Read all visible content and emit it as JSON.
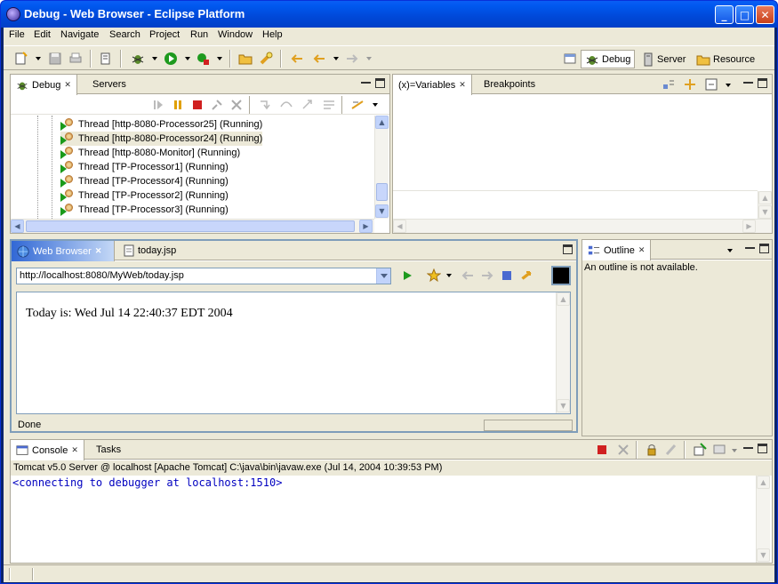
{
  "window": {
    "title": "Debug - Web Browser - Eclipse Platform",
    "buttons": {
      "minimize": "_",
      "maximize": "□",
      "close": "✕"
    }
  },
  "menu": [
    "File",
    "Edit",
    "Navigate",
    "Search",
    "Project",
    "Run",
    "Window",
    "Help"
  ],
  "perspectives": [
    {
      "label": "Debug",
      "icon": "debug-bug-icon",
      "active": true
    },
    {
      "label": "Server",
      "icon": "server-icon",
      "active": false
    },
    {
      "label": "Resource",
      "icon": "resource-folder-icon",
      "active": false
    }
  ],
  "debug_view": {
    "tabs": [
      {
        "label": "Debug",
        "active": true
      },
      {
        "label": "Servers",
        "active": false
      }
    ],
    "threads": [
      "Thread [http-8080-Processor25] (Running)",
      "Thread [http-8080-Processor24] (Running)",
      "Thread [http-8080-Monitor] (Running)",
      "Thread [TP-Processor1] (Running)",
      "Thread [TP-Processor4] (Running)",
      "Thread [TP-Processor2] (Running)",
      "Thread [TP-Processor3] (Running)"
    ]
  },
  "variables_view": {
    "tabs": [
      {
        "label": "(x)=Variables",
        "active": true
      },
      {
        "label": "Breakpoints",
        "active": false
      }
    ]
  },
  "browser_view": {
    "tabs": [
      {
        "label": "Web Browser",
        "active": true
      },
      {
        "label": "today.jsp",
        "active": false
      }
    ],
    "url": "http://localhost:8080/MyWeb/today.jsp",
    "content": "Today is: Wed Jul 14 22:40:37 EDT 2004",
    "status": "Done"
  },
  "outline_view": {
    "tab": "Outline",
    "message": "An outline is not available."
  },
  "console_view": {
    "tabs": [
      {
        "label": "Console",
        "active": true
      },
      {
        "label": "Tasks",
        "active": false
      }
    ],
    "header": "Tomcat v5.0 Server @ localhost [Apache Tomcat] C:\\java\\bin\\javaw.exe (Jul 14, 2004 10:39:53 PM)",
    "output": "<connecting to debugger at localhost:1510>"
  },
  "colors": {
    "title_bar": "#0058ee",
    "console_text": "#0000c0",
    "active_tab": "#3168d5",
    "chrome": "#ece9d8"
  }
}
